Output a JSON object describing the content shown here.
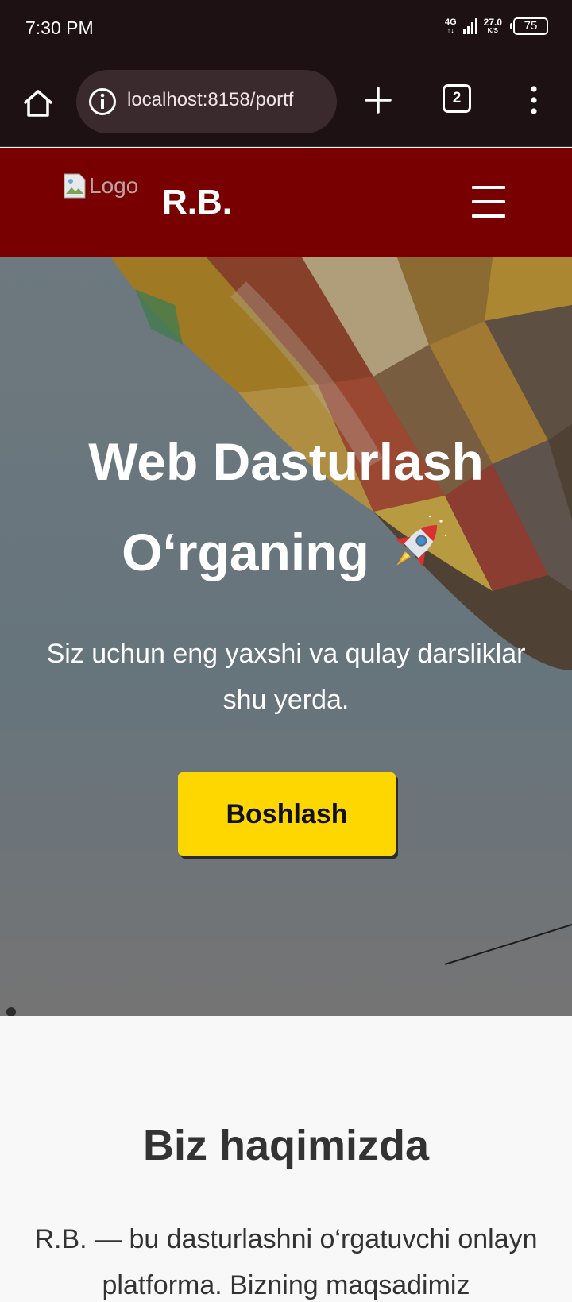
{
  "status_bar": {
    "time": "7:30 PM",
    "network": "4G",
    "speed": "27.0",
    "speed_unit": "K/S",
    "battery": "75"
  },
  "browser": {
    "url": "localhost:8158/portf",
    "tab_count": "2",
    "icons": [
      "home-icon",
      "info-icon",
      "plus-icon",
      "tabs-icon",
      "more-vert-icon"
    ]
  },
  "navbar": {
    "logo_alt": "Logo",
    "brand": "R.B.",
    "menu_icon": "hamburger-icon",
    "background": "#780000"
  },
  "hero": {
    "title_line1": "Web Dasturlash",
    "title_line2": "O‘rganing",
    "title_emoji": "rocket-emoji",
    "subtitle": "Siz uchun eng yaxshi va qulay darsliklar shu yerda.",
    "button_label": "Boshlash",
    "button_color": "#ffd700"
  },
  "about": {
    "title": "Biz haqimizda",
    "text": "R.B. — bu dasturlashni o‘rgatuvchi onlayn platforma. Bizning maqsadimiz"
  }
}
